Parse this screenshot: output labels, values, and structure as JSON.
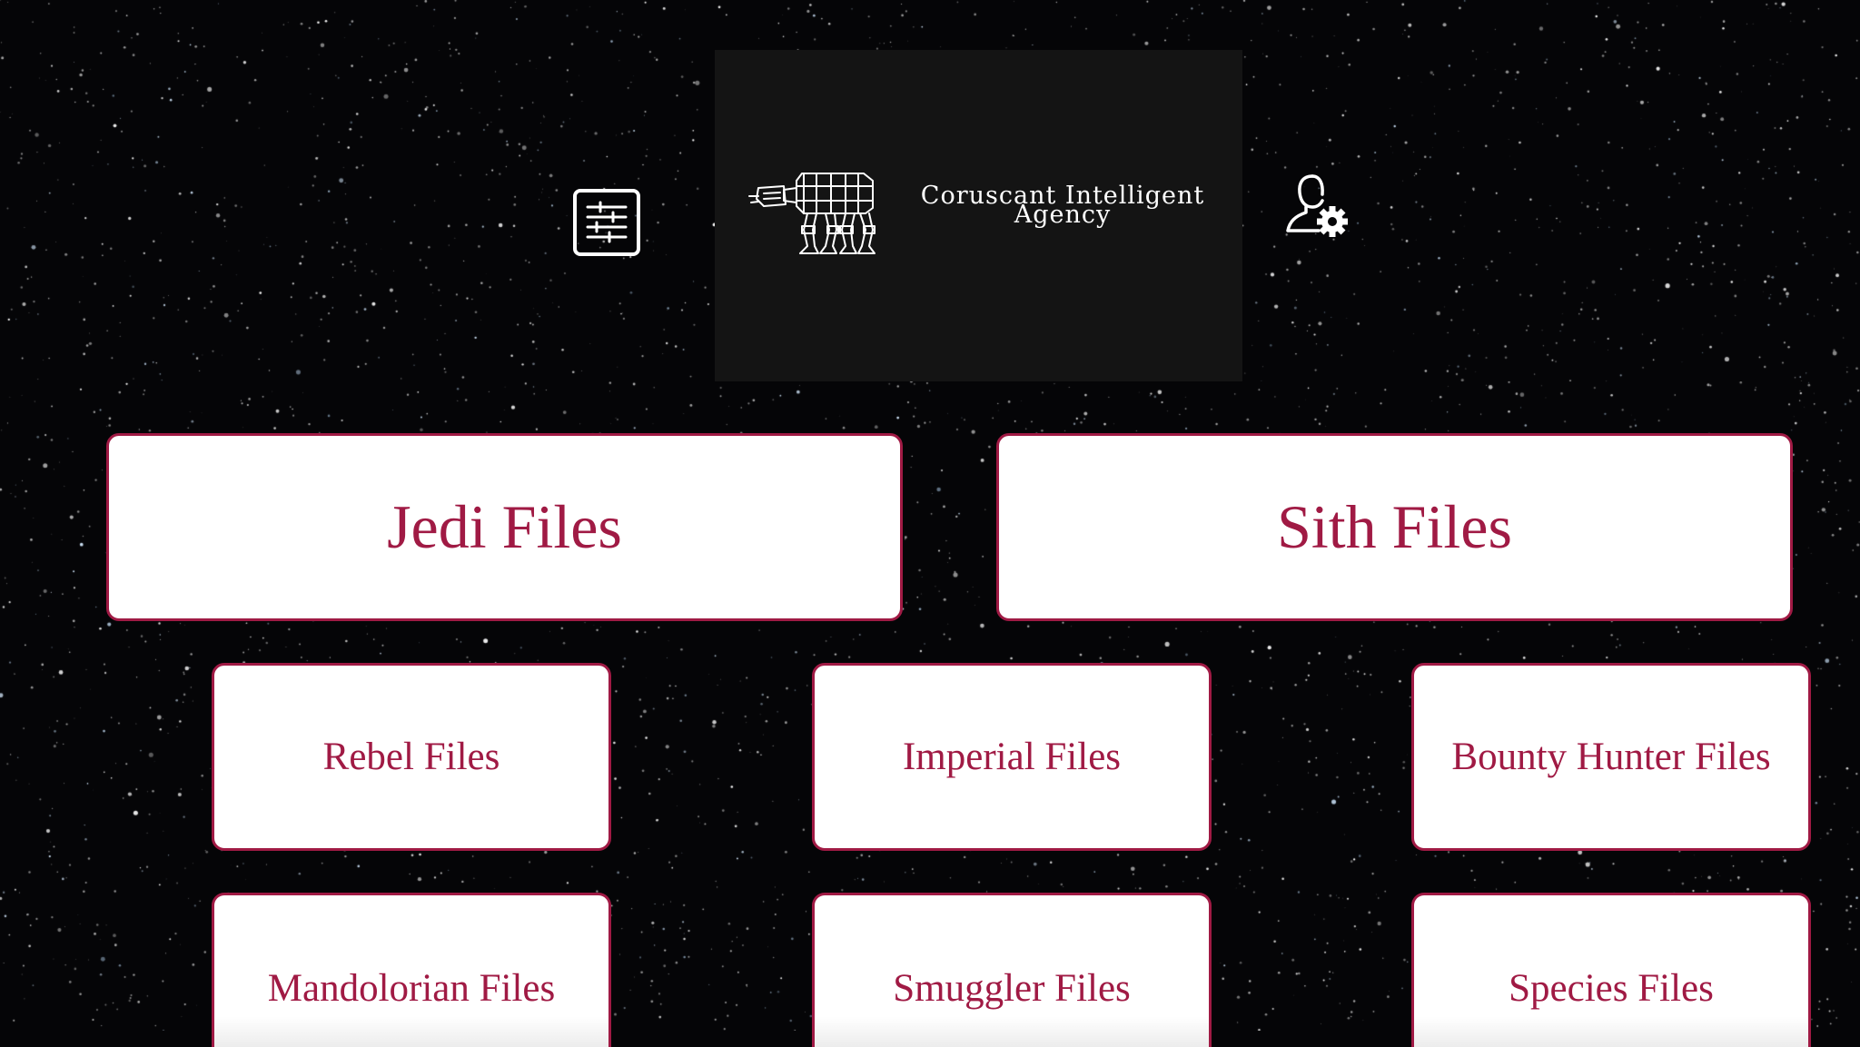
{
  "header": {
    "brand_line1": "Coruscant Intelligent",
    "brand_line2": "Agency",
    "logo_icon": "at-at-walker-icon",
    "menu_icon": "sliders-menu-icon",
    "admin_icon": "user-settings-icon"
  },
  "cards": {
    "jedi": "Jedi Files",
    "sith": "Sith Files",
    "rebel": "Rebel Files",
    "imperial": "Imperial Files",
    "bounty_hunter": "Bounty Hunter Files",
    "mandolorian": "Mandolorian Files",
    "smuggler": "Smuggler Files",
    "species": "Species Files"
  },
  "colors": {
    "accent": "#a01a44",
    "background": "#050507",
    "header_box": "#141414",
    "card_bg": "#ffffff"
  }
}
